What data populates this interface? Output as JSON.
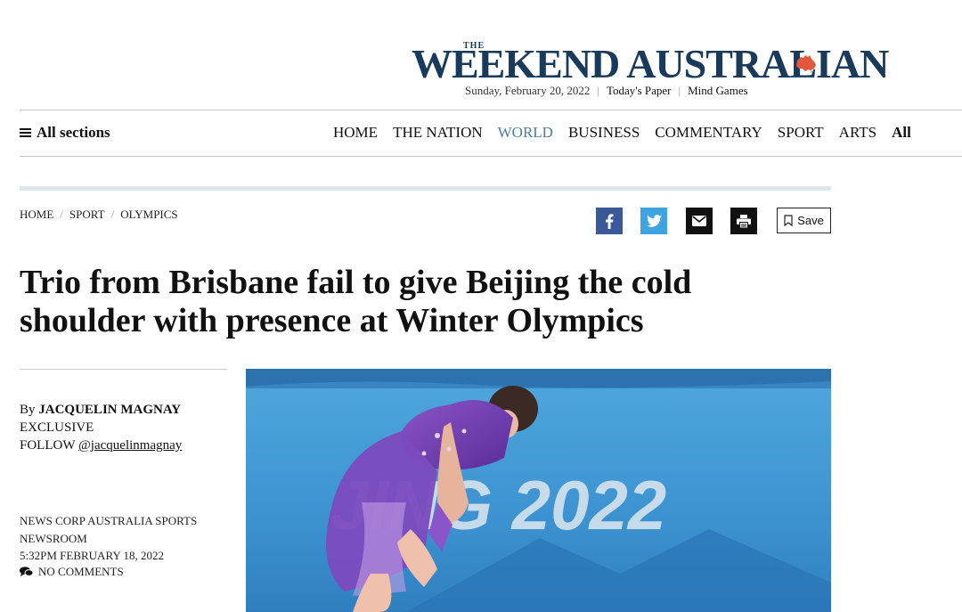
{
  "masthead": {
    "the": "THE",
    "title": "WEEKEND AUSTRALIAN",
    "date": "Sunday, February 20, 2022",
    "todays_paper": "Today's Paper",
    "mind_games": "Mind Games"
  },
  "nav": {
    "all_sections": "All sections",
    "items": [
      "HOME",
      "THE NATION",
      "WORLD",
      "BUSINESS",
      "COMMENTARY",
      "SPORT",
      "ARTS",
      "All"
    ],
    "active": "WORLD"
  },
  "breadcrumb": [
    "HOME",
    "SPORT",
    "OLYMPICS"
  ],
  "share": {
    "icons": [
      "facebook-icon",
      "twitter-icon",
      "email-icon",
      "print-icon"
    ],
    "save_label": "Save"
  },
  "article": {
    "headline": "Trio from Brisbane fail to give Beijing the cold shoulder with presence at Winter Olympics",
    "by_prefix": "By",
    "author": "JACQUELIN MAGNAY",
    "exclusive": "EXCLUSIVE",
    "follow_prefix": "FOLLOW",
    "follow_handle": "@jacquelinmagnay",
    "newsroom_line1": "NEWS CORP AUSTRALIA SPORTS",
    "newsroom_line2": "NEWSROOM",
    "timestamp": "5:32PM FEBRUARY 18, 2022",
    "comments": "NO COMMENTS",
    "photo_text": "JING 2022"
  },
  "colors": {
    "brand_navy": "#1a3a5c",
    "nav_active": "#4a7da3",
    "facebook": "#3b5998",
    "twitter": "#3fa3e0",
    "accent_bar": "#dce7ed",
    "aus_map": "#e4573d"
  }
}
